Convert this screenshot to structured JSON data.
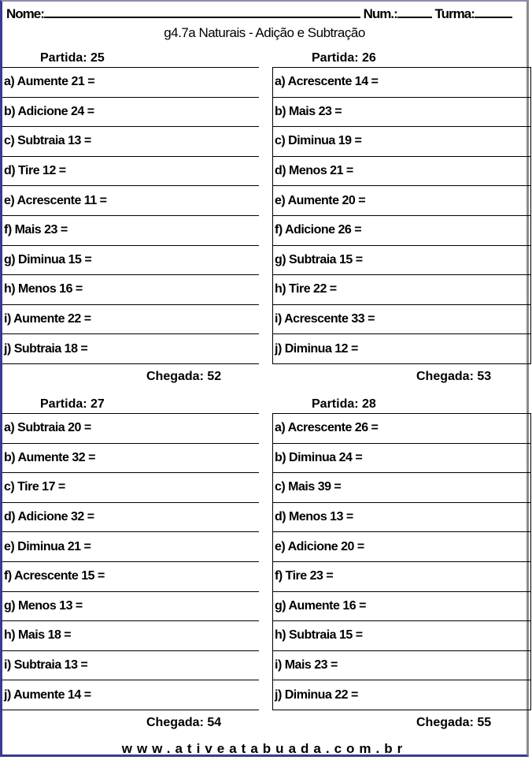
{
  "header": {
    "name_label": "Nome:",
    "num_label": "Num.:",
    "class_label": "Turma:"
  },
  "title": "g4.7a Naturais - Adição e Subtração",
  "panels": [
    {
      "start": "Partida: 25",
      "items": [
        "a) Aumente 21 =",
        "b) Adicione 24 =",
        "c) Subtraia 13 =",
        "d) Tire 12 =",
        "e) Acrescente 11 =",
        "f) Mais 23 =",
        "g) Diminua 15 =",
        "h) Menos 16 =",
        "i) Aumente 22 =",
        "j) Subtraia 18 ="
      ],
      "end": "Chegada: 52"
    },
    {
      "start": "Partida: 26",
      "items": [
        "a) Acrescente 14 =",
        "b) Mais 23 =",
        "c) Diminua 19 =",
        "d) Menos 21 =",
        "e) Aumente 20 =",
        "f) Adicione 26 =",
        "g) Subtraia 15 =",
        "h) Tire 22 =",
        "i) Acrescente 33 =",
        "j) Diminua 12 ="
      ],
      "end": "Chegada: 53"
    },
    {
      "start": "Partida: 27",
      "items": [
        "a) Subtraia 20 =",
        "b) Aumente 32 =",
        "c) Tire 17 =",
        "d) Adicione 32 =",
        "e) Diminua 21 =",
        "f) Acrescente 15 =",
        "g) Menos 13 =",
        "h) Mais 18 =",
        "i) Subtraia 13 =",
        "j) Aumente 14 ="
      ],
      "end": "Chegada: 54"
    },
    {
      "start": "Partida: 28",
      "items": [
        "a) Acrescente 26 =",
        "b) Diminua 24 =",
        "c) Mais 39 =",
        "d) Menos 13 =",
        "e) Adicione 20 =",
        "f) Tire 23 =",
        "g) Aumente 16 =",
        "h) Subtraia 15 =",
        "i) Mais 23 =",
        "j) Diminua 22 ="
      ],
      "end": "Chegada: 55"
    }
  ],
  "footer": "www.ativeatabuada.com.br"
}
